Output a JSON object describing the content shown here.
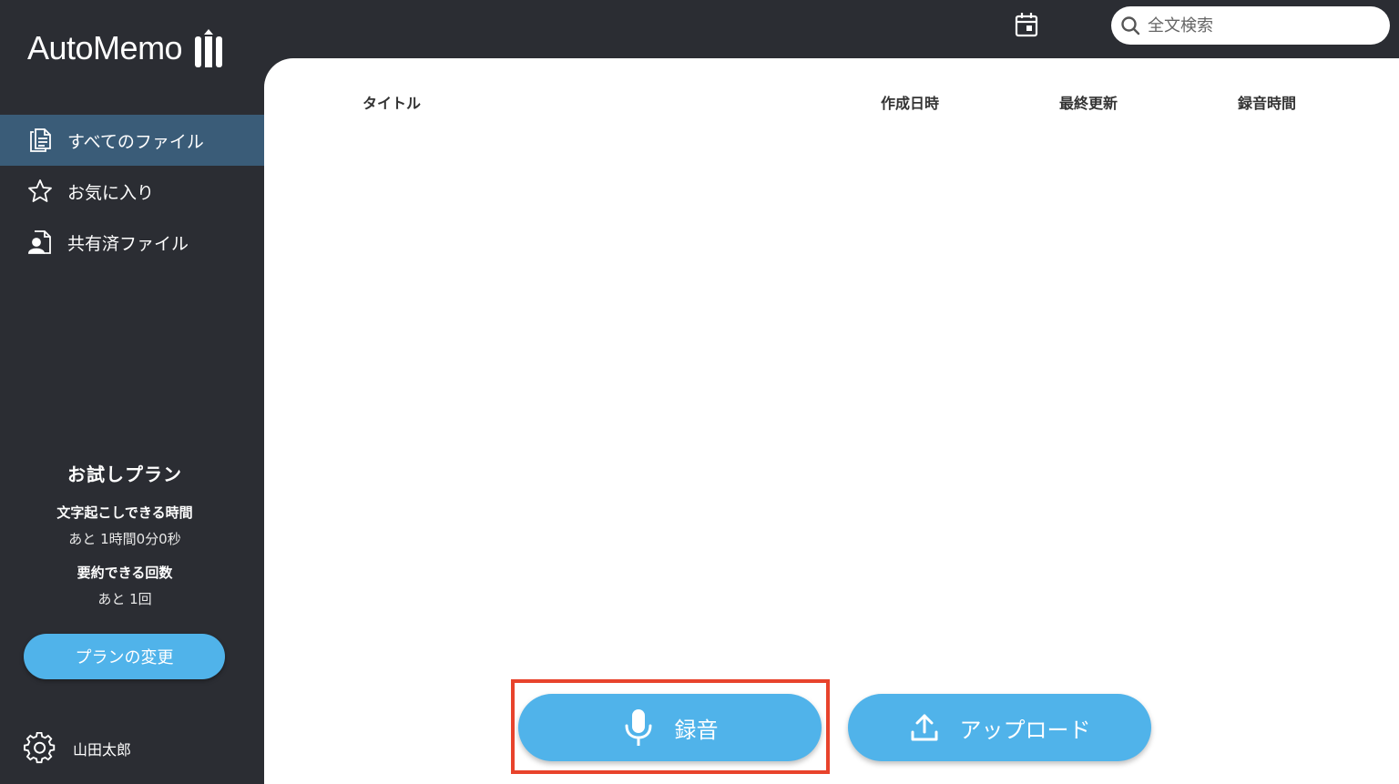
{
  "app": {
    "name": "AutoMemo"
  },
  "nav": {
    "items": [
      {
        "label": "すべてのファイル",
        "icon": "files-icon",
        "active": true
      },
      {
        "label": "お気に入り",
        "icon": "star-icon",
        "active": false
      },
      {
        "label": "共有済ファイル",
        "icon": "shared-file-icon",
        "active": false
      }
    ]
  },
  "plan": {
    "title": "お試しプラン",
    "transcription_label": "文字起こしできる時間",
    "transcription_remaining": "あと 1時間0分0秒",
    "summary_label": "要約できる回数",
    "summary_remaining": "あと 1回",
    "change_button": "プランの変更"
  },
  "user": {
    "name": "山田太郎"
  },
  "search": {
    "placeholder": "全文検索",
    "value": ""
  },
  "table": {
    "columns": [
      "タイトル",
      "作成日時",
      "最終更新",
      "録音時間"
    ],
    "rows": []
  },
  "actions": {
    "record_label": "録音",
    "upload_label": "アップロード"
  },
  "colors": {
    "sidebar": "#2b2d33",
    "active_nav": "#3a5c78",
    "accent": "#50b3ea",
    "highlight": "#e8432c"
  }
}
